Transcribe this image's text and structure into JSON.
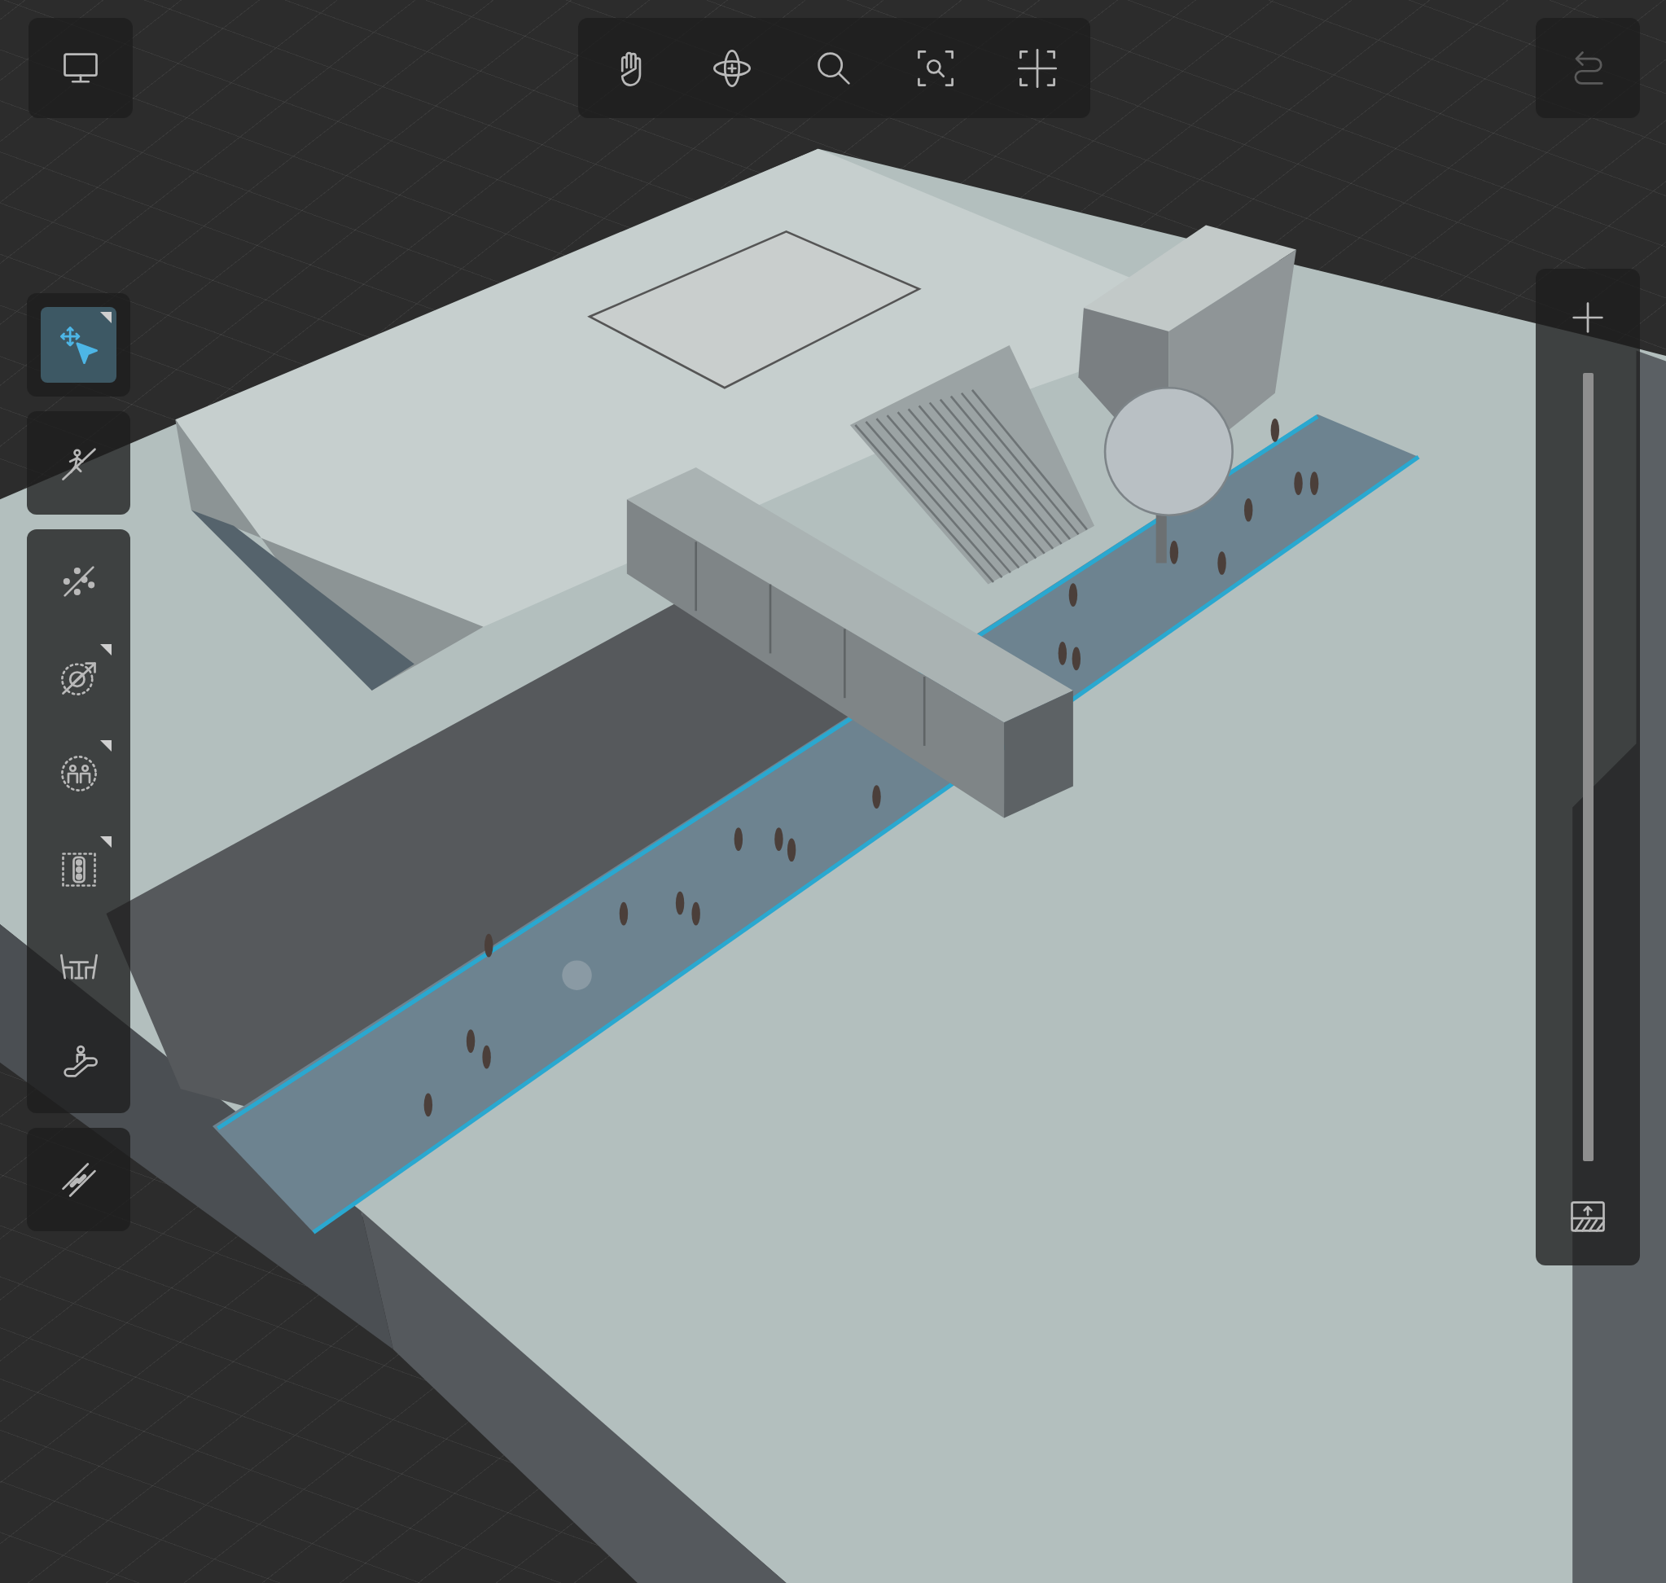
{
  "view_button": {
    "kind": "monitor"
  },
  "view_tools": [
    {
      "kind": "pan"
    },
    {
      "kind": "orbit"
    },
    {
      "kind": "zoom"
    },
    {
      "kind": "zoom_region"
    },
    {
      "kind": "fit"
    }
  ],
  "undo": {
    "disabled": true
  },
  "tool_groups": [
    {
      "tools": [
        {
          "kind": "move_select",
          "selected": true,
          "flyout": true
        }
      ]
    },
    {
      "tools": [
        {
          "kind": "walk_path",
          "selected": false,
          "flyout": false
        }
      ]
    },
    {
      "tools": [
        {
          "kind": "dots_line",
          "selected": false,
          "flyout": false
        },
        {
          "kind": "blocked_path",
          "selected": false,
          "flyout": true
        },
        {
          "kind": "people_group",
          "selected": false,
          "flyout": true
        },
        {
          "kind": "traffic_light",
          "selected": false,
          "flyout": true
        },
        {
          "kind": "table_chairs",
          "selected": false,
          "flyout": false
        },
        {
          "kind": "escalator",
          "selected": false,
          "flyout": false
        }
      ]
    },
    {
      "tools": [
        {
          "kind": "dashed_lines",
          "selected": false,
          "flyout": false
        }
      ]
    }
  ],
  "zoom_panel": {
    "buttons": [
      {
        "kind": "plus"
      },
      {
        "kind": "floor"
      }
    ]
  }
}
